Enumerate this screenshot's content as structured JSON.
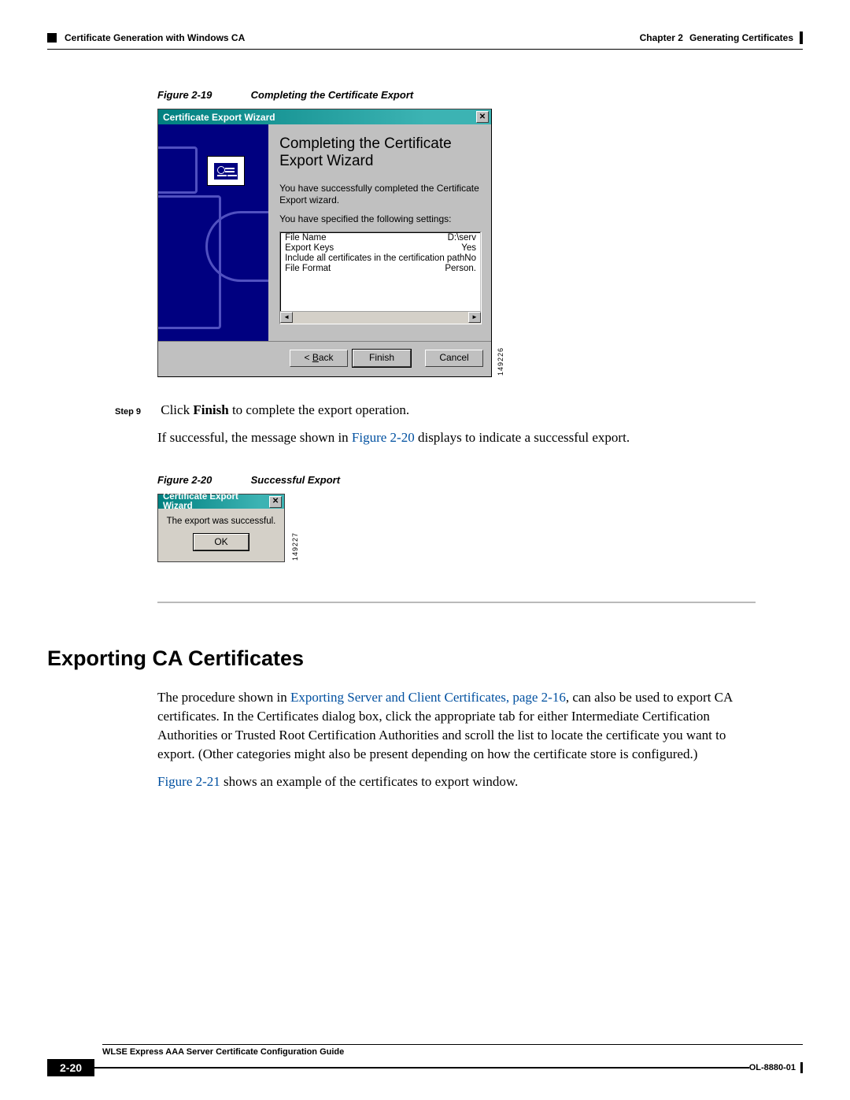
{
  "header": {
    "section_left": "Certificate Generation with Windows CA",
    "chapter_label": "Chapter 2",
    "chapter_title": "Generating Certificates"
  },
  "fig19": {
    "number": "Figure 2-19",
    "caption": "Completing the Certificate Export",
    "titlebar": "Certificate Export Wizard",
    "heading": "Completing the Certificate Export Wizard",
    "line1": "You have successfully completed the Certificate Export wizard.",
    "line2": "You have specified the following settings:",
    "rows": [
      {
        "k": "File Name",
        "v": "D:\\serv"
      },
      {
        "k": "Export Keys",
        "v": "Yes"
      },
      {
        "k": "Include all certificates in the certification path",
        "v": "No"
      },
      {
        "k": "File Format",
        "v": "Person."
      }
    ],
    "btn_back_pre": "< ",
    "btn_back_u": "B",
    "btn_back_post": "ack",
    "btn_finish": "Finish",
    "btn_cancel": "Cancel",
    "side_id": "149226"
  },
  "step9": {
    "label": "Step 9",
    "pre": "Click ",
    "bold": "Finish",
    "post": " to complete the export operation.",
    "line2a": "If successful, the message shown in ",
    "line2link": "Figure 2-20",
    "line2b": " displays to indicate a successful export."
  },
  "fig20": {
    "number": "Figure 2-20",
    "caption": "Successful Export",
    "titlebar": "Certificate Export Wizard",
    "msg": "The export was successful.",
    "ok": "OK",
    "side_id": "149227"
  },
  "section": {
    "heading": "Exporting CA Certificates",
    "p1a": "The procedure shown in ",
    "p1link": "Exporting Server and Client Certificates, page 2-16",
    "p1b": ", can also be used to export CA certificates. In the Certificates dialog box, click the appropriate tab for either Intermediate Certification Authorities or Trusted Root Certification Authorities and scroll the list to locate the certificate you want to export. (Other categories might also be present depending on how the certificate store is configured.)",
    "p2a": "",
    "p2link": "Figure 2-21",
    "p2b": " shows an example of the certificates to export window."
  },
  "footer": {
    "guide": "WLSE Express AAA Server Certificate Configuration Guide",
    "pagenum": "2-20",
    "docid": "OL-8880-01"
  }
}
